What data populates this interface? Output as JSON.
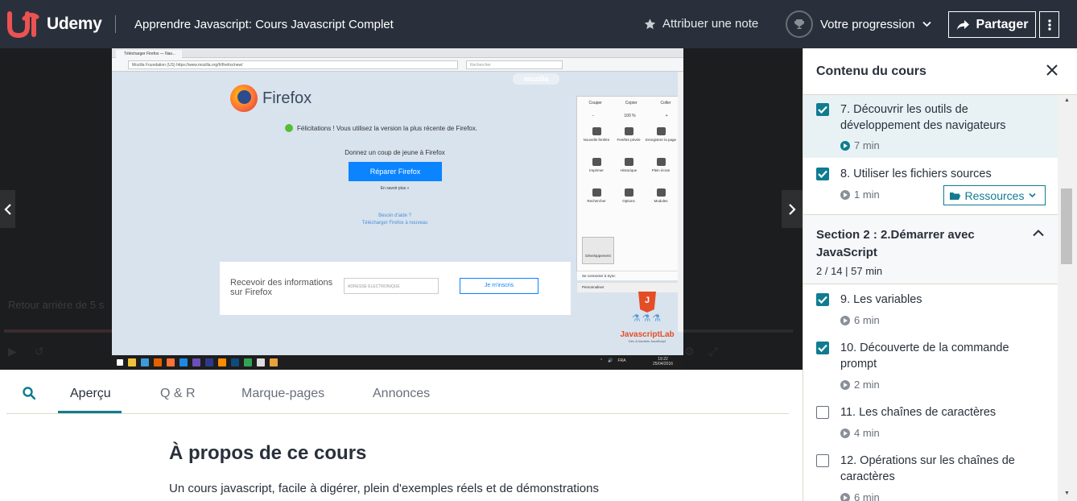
{
  "header": {
    "logo_text": "Udemy",
    "course_title": "Apprendre Javascript: Cours Javascript Complet",
    "rate_label": "Attribuer une note",
    "progress_label": "Votre progression",
    "share_label": "Partager",
    "colors": {
      "bg": "#29303b",
      "brand": "#ec5252"
    }
  },
  "video": {
    "browser_tab": "Télécharger Firefox — Nav...",
    "url": "Mozilla Foundation (US)  https://www.mozilla.org/fr/firefox/new/",
    "search_placeholder": "Rechercher",
    "mozilla_tag": "mozilla",
    "firefox_word": "Firefox",
    "congrats": "Félicitations ! Vous utilisez la version la plus récente de Firefox.",
    "donnez": "Donnez un coup de jeune à Firefox",
    "reparer": "Réparer Firefox",
    "en_savoir": "En savoir plus »",
    "besoin_aide": "Besoin d'aide ?",
    "telecharger": "Télécharger Firefox à nouveau",
    "newsletter_text": "Recevoir des informations sur Firefox",
    "email_placeholder": "ADRESSE ÉLECTRONIQUE",
    "subscribe": "Je m'inscris",
    "menu": {
      "edit_row": [
        "Couper",
        "Copier",
        "Coller"
      ],
      "zoom_row": [
        "−",
        "100 %",
        "+"
      ],
      "tiles": [
        "Nouvelle fenêtre",
        "Fenêtre privée",
        "Enregistrer la page",
        "Imprimer",
        "Historique",
        "Plein écran",
        "Rechercher",
        "Options",
        "Modules"
      ],
      "dev": "Développement",
      "sync": "Se connecter à Sync",
      "personnaliser": "Personnaliser"
    },
    "jslab_text": "JavascriptLab",
    "jslab_sub": "Dev & tutoriels JavaScript",
    "taskbar_lang": "FRA",
    "taskbar_time": "19:22",
    "taskbar_date": "25/04/2016",
    "ghost_text": "Retour arrière de 5 s"
  },
  "tabs": {
    "items": [
      "Aperçu",
      "Q & R",
      "Marque-pages",
      "Annonces"
    ],
    "active": "Aperçu"
  },
  "about": {
    "title": "À propos de ce cours",
    "description": "Un cours javascript, facile à digérer, plein d'exemples réels et de démonstrations"
  },
  "sidebar": {
    "title": "Contenu du cours",
    "lessons": [
      {
        "title": "7. Découvrir les outils de développement des navigateurs",
        "duration": "7 min",
        "checked": true,
        "current": true
      },
      {
        "title": "8. Utiliser les fichiers sources",
        "duration": "1 min",
        "checked": true,
        "current": false
      },
      {
        "title": "9. Les variables",
        "duration": "6 min",
        "checked": true,
        "current": false
      },
      {
        "title": "10. Découverte de la commande prompt",
        "duration": "2 min",
        "checked": true,
        "current": false
      },
      {
        "title": "11. Les chaînes de caractères",
        "duration": "4 min",
        "checked": false,
        "current": false
      },
      {
        "title": "12. Opérations sur les chaînes de caractères",
        "duration": "6 min",
        "checked": false,
        "current": false
      }
    ],
    "resources_label": "Ressources",
    "section": {
      "title": "Section 2 : 2.Démarrer avec JavaScript",
      "meta": "2 / 14  |  57 min"
    },
    "accent": "#0f7c90"
  }
}
